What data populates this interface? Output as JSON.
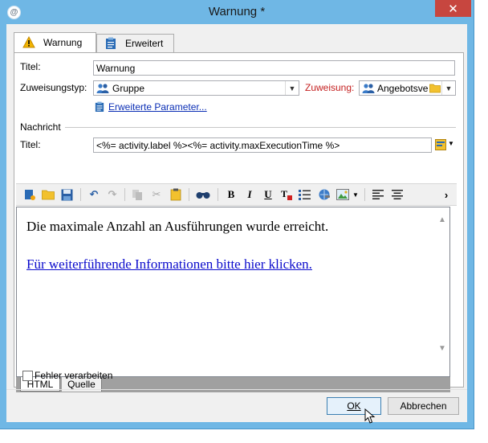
{
  "window": {
    "title": "Warnung *",
    "app_icon_glyph": "@",
    "close_glyph": "✕"
  },
  "tabs": [
    {
      "label": "Warnung",
      "icon": "warning-icon",
      "active": true
    },
    {
      "label": "Erweitert",
      "icon": "clipboard-icon",
      "active": false
    }
  ],
  "form": {
    "title_label": "Titel:",
    "title_value": "Warnung",
    "assignment_type_label": "Zuweisungstyp:",
    "assignment_type_value": "Gruppe",
    "assignment_label": "Zuweisung:",
    "assignment_value": "Angebotsve",
    "advanced_params_link": "Erweiterte Parameter...",
    "message_section_label": "Nachricht",
    "message_title_label": "Titel:",
    "message_title_value": "<%= activity.label %><%= activity.maxExecutionTime %>"
  },
  "toolbar": {
    "bold": "B",
    "italic": "I",
    "underline": "U",
    "more": "›"
  },
  "editor": {
    "line1": "Die maximale Anzahl an Ausführungen wurde erreicht.",
    "link": "Für weiterführende Informationen bitte hier klicken."
  },
  "source_tabs": [
    {
      "label": "HTML",
      "active": true
    },
    {
      "label": "Quelle",
      "active": false
    }
  ],
  "checkbox": {
    "label": "Fehler verarbeiten",
    "checked": false
  },
  "buttons": {
    "ok": "OK",
    "cancel": "Abbrechen"
  },
  "colors": {
    "titlebar": "#6fb7e5",
    "close": "#c7463f",
    "link": "#0b2fb5",
    "required_label": "#c41e1e"
  }
}
